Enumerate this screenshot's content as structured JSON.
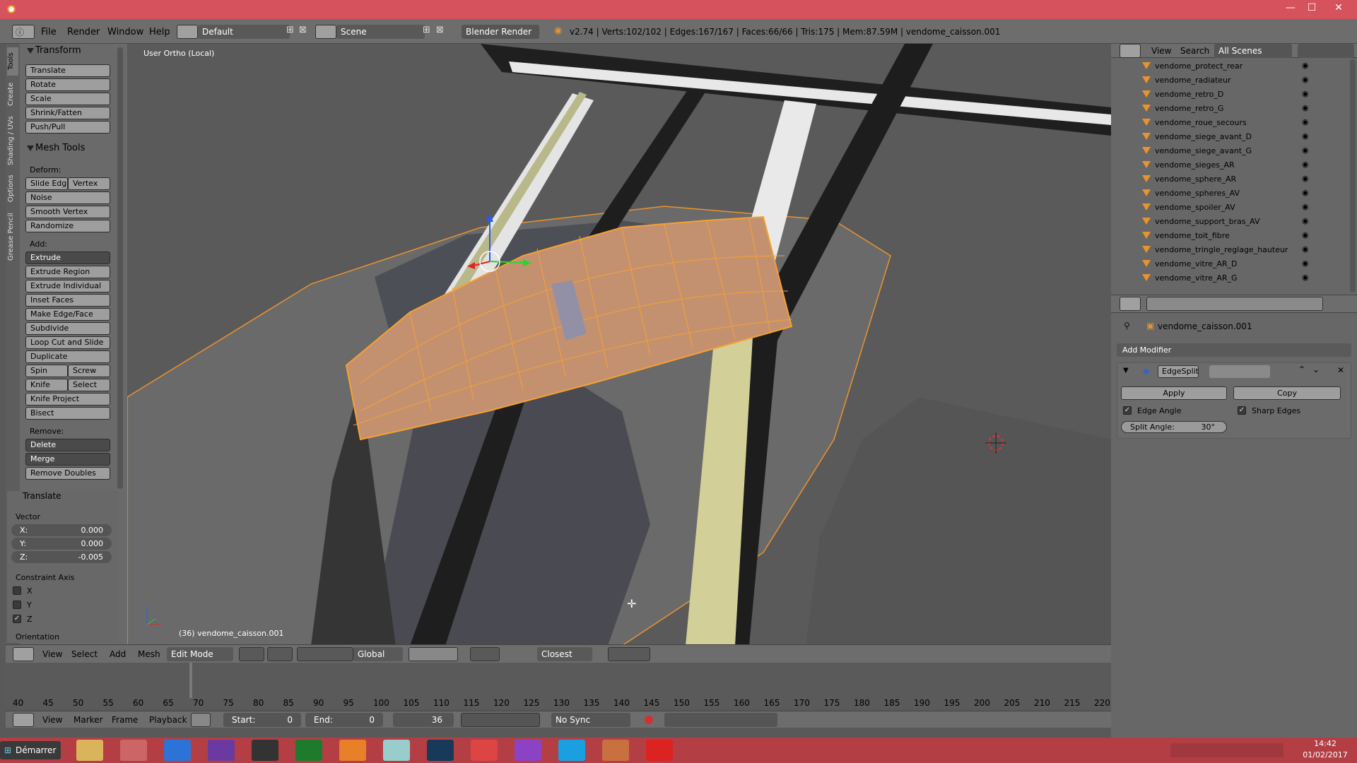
{
  "titlebar": {
    "minimize": "—",
    "maximize": "☐",
    "close": "✕"
  },
  "topbar": {
    "menus": [
      "File",
      "Render",
      "Window",
      "Help"
    ],
    "layout": "Default",
    "scene": "Scene",
    "engine": "Blender Render",
    "stats": "v2.74 | Verts:102/102 | Edges:167/167 | Faces:66/66 | Tris:175 | Mem:87.59M | vendome_caisson.001"
  },
  "tabs": [
    "Tools",
    "Create",
    "Shading / UVs",
    "Options",
    "Grease Pencil"
  ],
  "toolshelf": {
    "transform_header": "Transform",
    "transform": [
      "Translate",
      "Rotate",
      "Scale",
      "Shrink/Fatten",
      "Push/Pull"
    ],
    "mesh_header": "Mesh Tools",
    "deform_label": "Deform:",
    "slide_edge": "Slide Edg",
    "vertex": "Vertex",
    "noise": "Noise",
    "smooth_vertex": "Smooth Vertex",
    "randomize": "Randomize",
    "add_label": "Add:",
    "extrude": "Extrude",
    "add_items": [
      "Extrude Region",
      "Extrude Individual",
      "Inset Faces",
      "Make Edge/Face",
      "Subdivide",
      "Loop Cut and Slide",
      "Duplicate"
    ],
    "spin": "Spin",
    "screw": "Screw",
    "knife": "Knife",
    "select": "Select",
    "knife_project": "Knife Project",
    "bisect": "Bisect",
    "remove_label": "Remove:",
    "delete": "Delete",
    "merge": "Merge",
    "remove_doubles": "Remove Doubles"
  },
  "operator": {
    "header": "Translate",
    "vector_label": "Vector",
    "x_label": "X:",
    "x_value": "0.000",
    "y_label": "Y:",
    "y_value": "0.000",
    "z_label": "Z:",
    "z_value": "-0.005",
    "constraint_label": "Constraint Axis",
    "cx": "X",
    "cy": "Y",
    "cz": "Z",
    "orientation_label": "Orientation"
  },
  "viewport": {
    "view_name": "User Ortho (Local)",
    "object_label": "(36) vendome_caisson.001",
    "accent_orange": "#e8932e",
    "selection_fill": "#c9916a"
  },
  "viewport_header": {
    "menus": [
      "View",
      "Select",
      "Add",
      "Mesh"
    ],
    "mode": "Edit Mode",
    "orientation": "Global",
    "snap": "Closest"
  },
  "timeline": {
    "ticks": [
      "40",
      "45",
      "50",
      "55",
      "60",
      "65",
      "70",
      "75",
      "80",
      "85",
      "90",
      "95",
      "100",
      "105",
      "110",
      "115",
      "120",
      "125",
      "130",
      "135",
      "140",
      "145",
      "150",
      "155",
      "160",
      "165",
      "170",
      "175",
      "180",
      "185",
      "190",
      "195",
      "200",
      "205",
      "210",
      "215",
      "220"
    ],
    "menus": [
      "View",
      "Marker",
      "Frame",
      "Playback"
    ],
    "start_label": "Start:",
    "start_value": "0",
    "end_label": "End:",
    "end_value": "0",
    "current_frame": "36",
    "sync": "No Sync"
  },
  "outliner": {
    "view": "View",
    "search": "Search",
    "filter": "All Scenes",
    "items": [
      "vendome_protect_rear",
      "vendome_radiateur",
      "vendome_retro_D",
      "vendome_retro_G",
      "vendome_roue_secours",
      "vendome_siege_avant_D",
      "vendome_siege_avant_G",
      "vendome_sieges_AR",
      "vendome_sphere_AR",
      "vendome_spheres_AV",
      "vendome_spoiler_AV",
      "vendome_support_bras_AV",
      "vendome_toit_fibre",
      "vendome_tringle_reglage_hauteur",
      "vendome_vitre_AR_D",
      "vendome_vitre_AR_G"
    ]
  },
  "properties": {
    "object_name": "vendome_caisson.001",
    "add_modifier": "Add Modifier",
    "modifier_name": "EdgeSplit",
    "apply": "Apply",
    "copy": "Copy",
    "edge_angle": "Edge Angle",
    "sharp_edges": "Sharp Edges",
    "split_angle_label": "Split Angle:",
    "split_angle_value": "30°"
  },
  "taskbar": {
    "start": "Démarrer",
    "time": "14:42",
    "date": "01/02/2017"
  }
}
